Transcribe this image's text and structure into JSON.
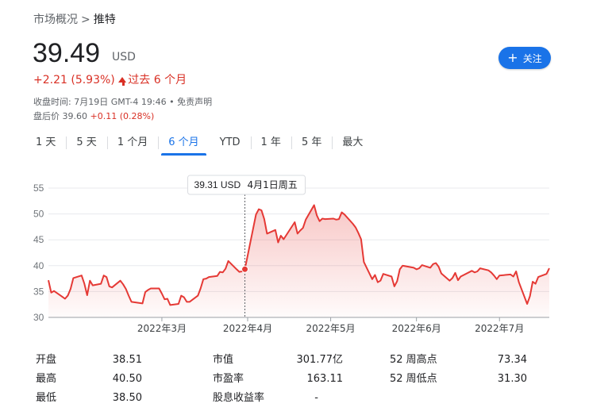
{
  "breadcrumb": {
    "parent": "市场概况",
    "separator": ">",
    "current": "推特"
  },
  "quote": {
    "price": "39.49",
    "currency": "USD",
    "change": "+2.21 (5.93%)",
    "period": "过去 6 个月",
    "close_time": "收盘时间: 7月19日 GMT-4 19:46 • 免责声明",
    "after_hours_label": "盘后价 39.60",
    "after_hours_change": "+0.11 (0.28%)"
  },
  "follow_button": {
    "label": "关注",
    "icon": "plus-icon"
  },
  "tabs": [
    {
      "label": "1 天",
      "active": false
    },
    {
      "label": "5 天",
      "active": false
    },
    {
      "label": "1 个月",
      "active": false
    },
    {
      "label": "6 个月",
      "active": true
    },
    {
      "label": "YTD",
      "active": false
    },
    {
      "label": "1 年",
      "active": false
    },
    {
      "label": "5 年",
      "active": false
    },
    {
      "label": "最大",
      "active": false
    }
  ],
  "colors": {
    "accent": "#1a73e8",
    "line": "#e53935",
    "negative_change": "#d93025"
  },
  "chart_data": {
    "type": "area",
    "ylim": [
      30,
      55
    ],
    "yticks": [
      30,
      35,
      40,
      45,
      50,
      55
    ],
    "xticks": [
      {
        "label": "2022年3月",
        "date": "2022-03-01"
      },
      {
        "label": "2022年4月",
        "date": "2022-04-01"
      },
      {
        "label": "2022年5月",
        "date": "2022-05-01"
      },
      {
        "label": "2022年6月",
        "date": "2022-06-01"
      },
      {
        "label": "2022年7月",
        "date": "2022-07-01"
      }
    ],
    "grid": true,
    "tooltip": {
      "price": "39.31 USD",
      "date": "4月1日周五",
      "highlight_date": "2022-04-01",
      "highlight_value": 39.31
    },
    "series": [
      {
        "values": [
          [
            "2022-01-19",
            37.2
          ],
          [
            "2022-01-20",
            34.8
          ],
          [
            "2022-01-21",
            35.1
          ],
          [
            "2022-01-24",
            34.0
          ],
          [
            "2022-01-25",
            33.6
          ],
          [
            "2022-01-26",
            34.2
          ],
          [
            "2022-01-27",
            35.5
          ],
          [
            "2022-01-28",
            37.6
          ],
          [
            "2022-01-31",
            38.1
          ],
          [
            "2022-02-01",
            36.5
          ],
          [
            "2022-02-02",
            34.3
          ],
          [
            "2022-02-03",
            37.1
          ],
          [
            "2022-02-04",
            36.2
          ],
          [
            "2022-02-07",
            36.5
          ],
          [
            "2022-02-08",
            38.1
          ],
          [
            "2022-02-09",
            37.8
          ],
          [
            "2022-02-10",
            36.0
          ],
          [
            "2022-02-11",
            35.8
          ],
          [
            "2022-02-14",
            37.1
          ],
          [
            "2022-02-15",
            36.4
          ],
          [
            "2022-02-16",
            35.5
          ],
          [
            "2022-02-17",
            34.2
          ],
          [
            "2022-02-18",
            33.0
          ],
          [
            "2022-02-22",
            32.7
          ],
          [
            "2022-02-23",
            34.9
          ],
          [
            "2022-02-24",
            35.3
          ],
          [
            "2022-02-25",
            35.6
          ],
          [
            "2022-02-28",
            35.6
          ],
          [
            "2022-03-01",
            34.6
          ],
          [
            "2022-03-02",
            33.5
          ],
          [
            "2022-03-03",
            33.6
          ],
          [
            "2022-03-04",
            32.4
          ],
          [
            "2022-03-07",
            32.6
          ],
          [
            "2022-03-08",
            34.2
          ],
          [
            "2022-03-09",
            33.9
          ],
          [
            "2022-03-10",
            33.0
          ],
          [
            "2022-03-11",
            33.0
          ],
          [
            "2022-03-14",
            34.2
          ],
          [
            "2022-03-15",
            35.6
          ],
          [
            "2022-03-16",
            37.4
          ],
          [
            "2022-03-17",
            37.5
          ],
          [
            "2022-03-18",
            37.8
          ],
          [
            "2022-03-21",
            38.0
          ],
          [
            "2022-03-22",
            38.8
          ],
          [
            "2022-03-23",
            38.7
          ],
          [
            "2022-03-24",
            39.4
          ],
          [
            "2022-03-25",
            40.9
          ],
          [
            "2022-03-28",
            39.3
          ],
          [
            "2022-03-29",
            38.8
          ],
          [
            "2022-03-30",
            38.9
          ],
          [
            "2022-03-31",
            39.31
          ],
          [
            "2022-04-04",
            49.9
          ],
          [
            "2022-04-05",
            50.9
          ],
          [
            "2022-04-06",
            50.7
          ],
          [
            "2022-04-07",
            49.0
          ],
          [
            "2022-04-08",
            46.2
          ],
          [
            "2022-04-11",
            46.9
          ],
          [
            "2022-04-12",
            44.5
          ],
          [
            "2022-04-13",
            45.8
          ],
          [
            "2022-04-14",
            45.1
          ],
          [
            "2022-04-18",
            48.4
          ],
          [
            "2022-04-19",
            46.2
          ],
          [
            "2022-04-20",
            46.8
          ],
          [
            "2022-04-21",
            47.3
          ],
          [
            "2022-04-22",
            48.9
          ],
          [
            "2022-04-25",
            51.7
          ],
          [
            "2022-04-26",
            49.7
          ],
          [
            "2022-04-27",
            48.6
          ],
          [
            "2022-04-28",
            49.1
          ],
          [
            "2022-04-29",
            49.0
          ],
          [
            "2022-05-02",
            49.1
          ],
          [
            "2022-05-03",
            48.9
          ],
          [
            "2022-05-04",
            49.0
          ],
          [
            "2022-05-05",
            50.3
          ],
          [
            "2022-05-06",
            49.9
          ],
          [
            "2022-05-09",
            48.1
          ],
          [
            "2022-05-10",
            47.4
          ],
          [
            "2022-05-11",
            46.3
          ],
          [
            "2022-05-12",
            45.1
          ],
          [
            "2022-05-13",
            40.7
          ],
          [
            "2022-05-16",
            37.4
          ],
          [
            "2022-05-17",
            38.2
          ],
          [
            "2022-05-18",
            36.8
          ],
          [
            "2022-05-19",
            37.1
          ],
          [
            "2022-05-20",
            38.4
          ],
          [
            "2022-05-23",
            37.9
          ],
          [
            "2022-05-24",
            36.0
          ],
          [
            "2022-05-25",
            37.0
          ],
          [
            "2022-05-26",
            39.3
          ],
          [
            "2022-05-27",
            40.0
          ],
          [
            "2022-05-31",
            39.6
          ],
          [
            "2022-06-01",
            39.3
          ],
          [
            "2022-06-02",
            39.5
          ],
          [
            "2022-06-03",
            40.1
          ],
          [
            "2022-06-06",
            39.6
          ],
          [
            "2022-06-07",
            40.3
          ],
          [
            "2022-06-08",
            40.5
          ],
          [
            "2022-06-09",
            39.8
          ],
          [
            "2022-06-10",
            38.5
          ],
          [
            "2022-06-13",
            37.1
          ],
          [
            "2022-06-14",
            37.6
          ],
          [
            "2022-06-15",
            38.6
          ],
          [
            "2022-06-16",
            37.2
          ],
          [
            "2022-06-17",
            37.9
          ],
          [
            "2022-06-21",
            39.0
          ],
          [
            "2022-06-22",
            38.7
          ],
          [
            "2022-06-23",
            38.9
          ],
          [
            "2022-06-24",
            39.5
          ],
          [
            "2022-06-27",
            39.1
          ],
          [
            "2022-06-28",
            38.7
          ],
          [
            "2022-06-29",
            38.1
          ],
          [
            "2022-06-30",
            37.4
          ],
          [
            "2022-07-01",
            38.1
          ],
          [
            "2022-07-05",
            38.3
          ],
          [
            "2022-07-06",
            37.9
          ],
          [
            "2022-07-07",
            38.9
          ],
          [
            "2022-07-08",
            36.8
          ],
          [
            "2022-07-11",
            32.6
          ],
          [
            "2022-07-12",
            34.1
          ],
          [
            "2022-07-13",
            36.9
          ],
          [
            "2022-07-14",
            36.5
          ],
          [
            "2022-07-15",
            37.8
          ],
          [
            "2022-07-18",
            38.4
          ],
          [
            "2022-07-19",
            39.49
          ]
        ]
      }
    ]
  },
  "stats": [
    [
      {
        "label": "开盘",
        "value": "38.51"
      },
      {
        "label": "市值",
        "value": "301.77亿"
      },
      {
        "label": "52 周高点",
        "value": "73.34"
      }
    ],
    [
      {
        "label": "最高",
        "value": "40.50"
      },
      {
        "label": "市盈率",
        "value": "163.11"
      },
      {
        "label": "52 周低点",
        "value": "31.30"
      }
    ],
    [
      {
        "label": "最低",
        "value": "38.50"
      },
      {
        "label": "股息收益率",
        "value": "-"
      }
    ]
  ]
}
